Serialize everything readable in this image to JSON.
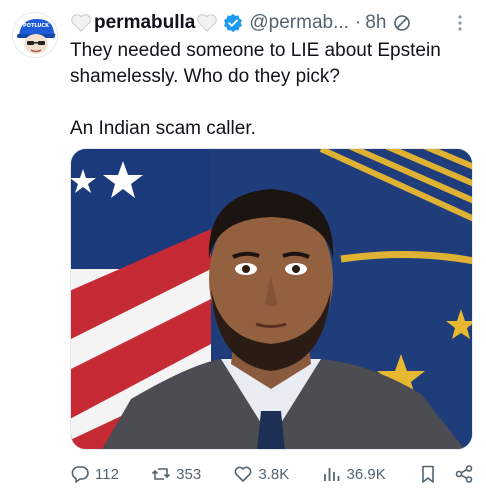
{
  "author": {
    "display_name": "permabulla",
    "handle": "@permab...",
    "separator": "·",
    "time": "8h",
    "avatar_text": "POTLUCK"
  },
  "tweet": {
    "line1": "They needed someone to LIE about Epstein shamelessly. Who do they pick?",
    "line2": "An Indian scam caller."
  },
  "actions": {
    "replies": "112",
    "reposts": "353",
    "likes": "3.8K",
    "views": "36.9K"
  },
  "colors": {
    "verified": "#1d9bf0",
    "muted": "#536471",
    "text": "#0f1419"
  },
  "icons": [
    "white-heart-icon",
    "verified-badge-icon",
    "edited-icon",
    "more-icon",
    "reply-icon",
    "repost-icon",
    "like-icon",
    "views-icon",
    "bookmark-icon",
    "share-icon"
  ]
}
